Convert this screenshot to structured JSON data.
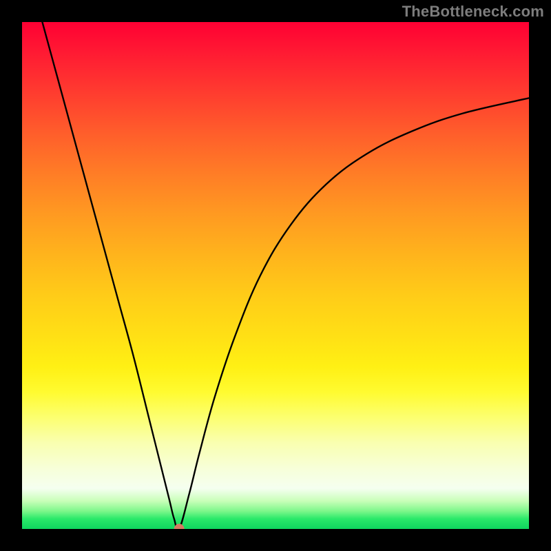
{
  "watermark": "TheBottleneck.com",
  "colors": {
    "curve": "#000000",
    "marker": "#d57a62",
    "frame": "#000000"
  },
  "chart_data": {
    "type": "line",
    "title": "",
    "xlabel": "",
    "ylabel": "",
    "xlim": [
      0,
      100
    ],
    "ylim": [
      0,
      100
    ],
    "grid": false,
    "legend": false,
    "marker": {
      "x": 31,
      "y": 0
    },
    "series": [
      {
        "name": "bottleneck-curve",
        "x": [
          4,
          7,
          10,
          13,
          16,
          19,
          22,
          25,
          27,
          29,
          30,
          31,
          33,
          35,
          38,
          42,
          47,
          53,
          60,
          68,
          77,
          87,
          100
        ],
        "y": [
          100,
          89,
          78,
          67,
          56,
          45,
          34,
          22,
          14,
          6,
          2,
          0,
          7,
          15,
          26,
          38,
          50,
          60,
          68,
          74,
          78.5,
          82,
          85
        ]
      }
    ]
  }
}
